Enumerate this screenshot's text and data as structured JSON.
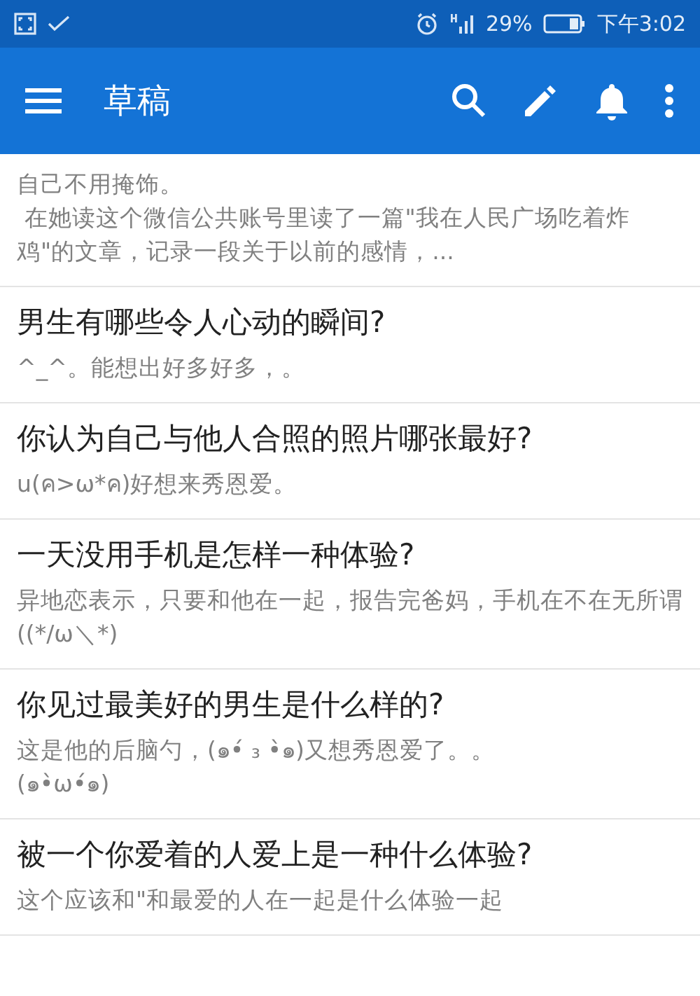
{
  "status_bar": {
    "battery": "29%",
    "time": "下午3:02"
  },
  "toolbar": {
    "title": "草稿"
  },
  "drafts": [
    {
      "snippet": [
        "自己不用掩饰。",
        " 在她读这个微信公共账号里读了一篇\"我在人民广场吃着炸鸡\"的文章，记录一段关于以前的感情，..."
      ]
    },
    {
      "title": "男生有哪些令人心动的瞬间?",
      "snippet": [
        "^_^。能想出好多好多，。"
      ]
    },
    {
      "title": "你认为自己与他人合照的照片哪张最好?",
      "snippet": [
        "u(ค>ω*ค)好想来秀恩爱。"
      ]
    },
    {
      "title": "一天没用手机是怎样一种体验?",
      "snippet": [
        "异地恋表示，只要和他在一起，报告完爸妈，手机在不在无所谓((*/ω＼*)"
      ]
    },
    {
      "title": "你见过最美好的男生是什么样的?",
      "snippet": [
        "这是他的后脑勺，(๑•́ ₃ •̀๑)又想秀恩爱了。。",
        "(๑•̀ω•́๑)"
      ]
    },
    {
      "title": "被一个你爱着的人爱上是一种什么体验?",
      "snippet": [
        "这个应该和\"和最爱的人在一起是什么体验一起"
      ]
    }
  ]
}
